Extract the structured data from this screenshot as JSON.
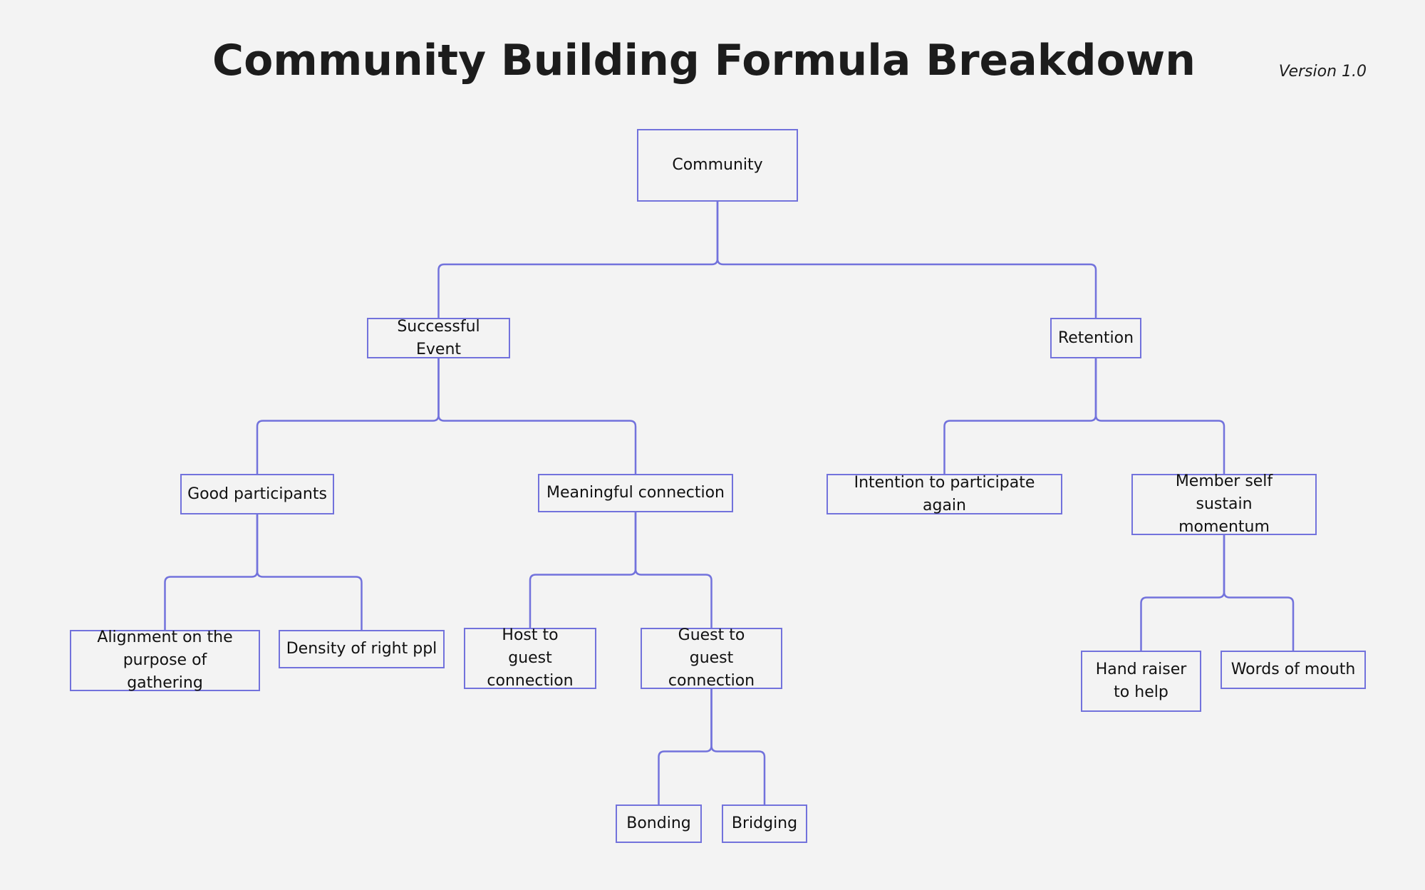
{
  "header": {
    "title": "Community Building Formula Breakdown",
    "version": "Version 1.0"
  },
  "colors": {
    "background": "#f3f3f3",
    "line": "#7272dc",
    "text": "#111111"
  },
  "nodes": {
    "community": {
      "label": "Community",
      "parent": null
    },
    "successful_event": {
      "label": "Successful Event",
      "parent": "community"
    },
    "retention": {
      "label": "Retention",
      "parent": "community"
    },
    "good_participants": {
      "label": "Good participants",
      "parent": "successful_event"
    },
    "meaningful_connection": {
      "label": "Meaningful connection",
      "parent": "successful_event"
    },
    "intention_again": {
      "label": "Intention to participate again",
      "parent": "retention"
    },
    "member_self_sustain": {
      "label": "Member self sustain momentum",
      "parent": "retention"
    },
    "alignment_purpose": {
      "label": "Alignment on the purpose of gathering",
      "parent": "good_participants"
    },
    "density_right_ppl": {
      "label": "Density of right ppl",
      "parent": "good_participants"
    },
    "host_to_guest": {
      "label": "Host to guest connection",
      "parent": "meaningful_connection"
    },
    "guest_to_guest": {
      "label": "Guest to guest connection",
      "parent": "meaningful_connection"
    },
    "hand_raiser": {
      "label": "Hand raiser to help",
      "parent": "member_self_sustain"
    },
    "words_of_mouth": {
      "label": "Words of mouth",
      "parent": "member_self_sustain"
    },
    "bonding": {
      "label": "Bonding",
      "parent": "guest_to_guest"
    },
    "bridging": {
      "label": "Bridging",
      "parent": "guest_to_guest"
    }
  }
}
